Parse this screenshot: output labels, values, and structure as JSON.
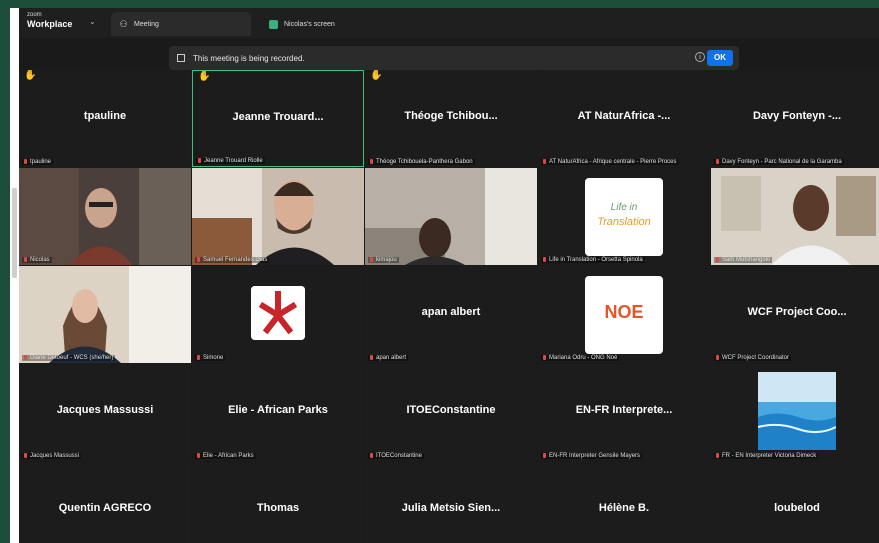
{
  "app": {
    "brand_small": "zoom",
    "brand_name": "Workplace",
    "brand_chevron": "⌄"
  },
  "tabs": [
    {
      "label": "Meeting"
    },
    {
      "label": "Nicolas's screen"
    }
  ],
  "recording_banner": {
    "message": "This meeting is being recorded.",
    "ok_label": "OK",
    "info": "i"
  },
  "participants": [
    {
      "display": "tpauline",
      "label": "tpauline",
      "hand": true
    },
    {
      "display": "Jeanne Trouard...",
      "label": "Jeanne Trouard Riolle",
      "hand": true,
      "highlighted": true
    },
    {
      "display": "Théoge Tchibou...",
      "label": "Théoge Tchibouela-Panthera Gabon",
      "hand": true
    },
    {
      "display": "AT NaturAfrica -...",
      "label": "AT NaturAfrica - Afrique centrale - Pierre Proces"
    },
    {
      "display": "Davy Fonteyn -...",
      "label": "Davy Fonteyn - Parc National de la Garamba"
    },
    {
      "display": "",
      "label": "Nicolas",
      "video": "man-glasses"
    },
    {
      "display": "",
      "label": "Samuel Fernandes Dias",
      "video": "man-beard"
    },
    {
      "display": "",
      "label": "kimajou",
      "video": "man-dark"
    },
    {
      "display": "",
      "label": "Life in Translation - Orsetta Spinola",
      "logo": "life-in-translation",
      "logo_text": [
        "Life in",
        "Translation"
      ]
    },
    {
      "display": "",
      "label": "Sam Mutshangolo",
      "video": "man-office"
    },
    {
      "display": "",
      "label": "Diane Detoeuf - WCS (she/her)",
      "video": "woman"
    },
    {
      "display": "",
      "label": "Simone",
      "logo": "red-star"
    },
    {
      "display": "apan albert",
      "label": "apan albert"
    },
    {
      "display": "",
      "label": "Mariana Odru - ONG Noé",
      "logo": "noe",
      "logo_text": [
        "NOE"
      ]
    },
    {
      "display": "WCF Project Coo...",
      "label": "WCF Project Coordinator"
    },
    {
      "display": "Jacques Massussi",
      "label": "Jacques Massussi"
    },
    {
      "display": "Elie - African Parks",
      "label": "Elie - African Parks"
    },
    {
      "display": "ITOEConstantine",
      "label": "ITOEConstantine"
    },
    {
      "display": "EN-FR Interprete...",
      "label": "EN-FR Interpreter Gensile Mayers"
    },
    {
      "display": "",
      "label": "FR - EN Interpreter Victoria Dimeck",
      "logo": "ocean"
    },
    {
      "display": "Quentin AGRECO",
      "label": "Quentin AGRECO"
    },
    {
      "display": "Thomas",
      "label": "Thomas"
    },
    {
      "display": "Julia Metsio Sien...",
      "label": "Julia Metsio Sienne"
    },
    {
      "display": "Hélène B.",
      "label": "Hélène B."
    },
    {
      "display": "loubelod",
      "label": "loubelod"
    }
  ],
  "colors": {
    "accent": "#0e72ed",
    "speaker": "#3ec27a",
    "hand": "#f1c232",
    "mic_muted": "#e04848"
  }
}
